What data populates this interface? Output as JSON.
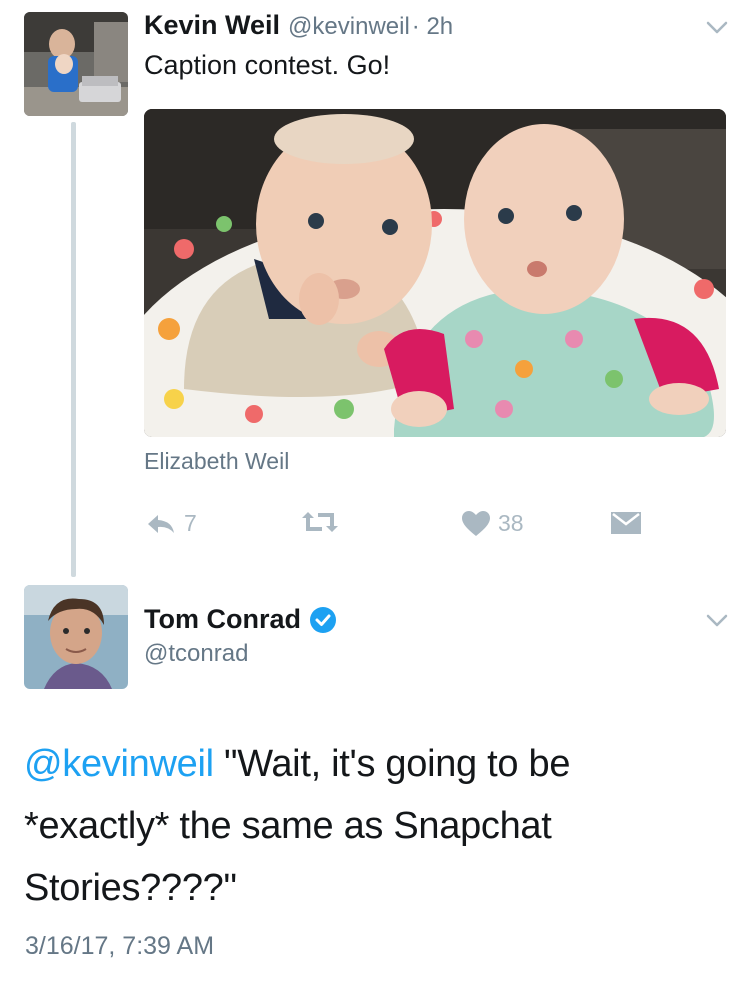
{
  "tweet1": {
    "name": "Kevin Weil",
    "handle": "@kevinweil",
    "time": "· 2h",
    "text": "Caption contest. Go!",
    "photo_tag": "Elizabeth Weil",
    "reply_count": "7",
    "like_count": "38"
  },
  "tweet2": {
    "name": "Tom Conrad",
    "handle": "@tconrad",
    "mention": "@kevinweil",
    "text": " \"Wait, it's going to be *exactly* the same as Snapchat Stories????\"",
    "timestamp": "3/16/17, 7:39 AM"
  },
  "colors": {
    "link": "#1da1f2",
    "secondary_text": "#657786",
    "action_icon": "#aab8c2",
    "verified": "#1da1f2"
  }
}
